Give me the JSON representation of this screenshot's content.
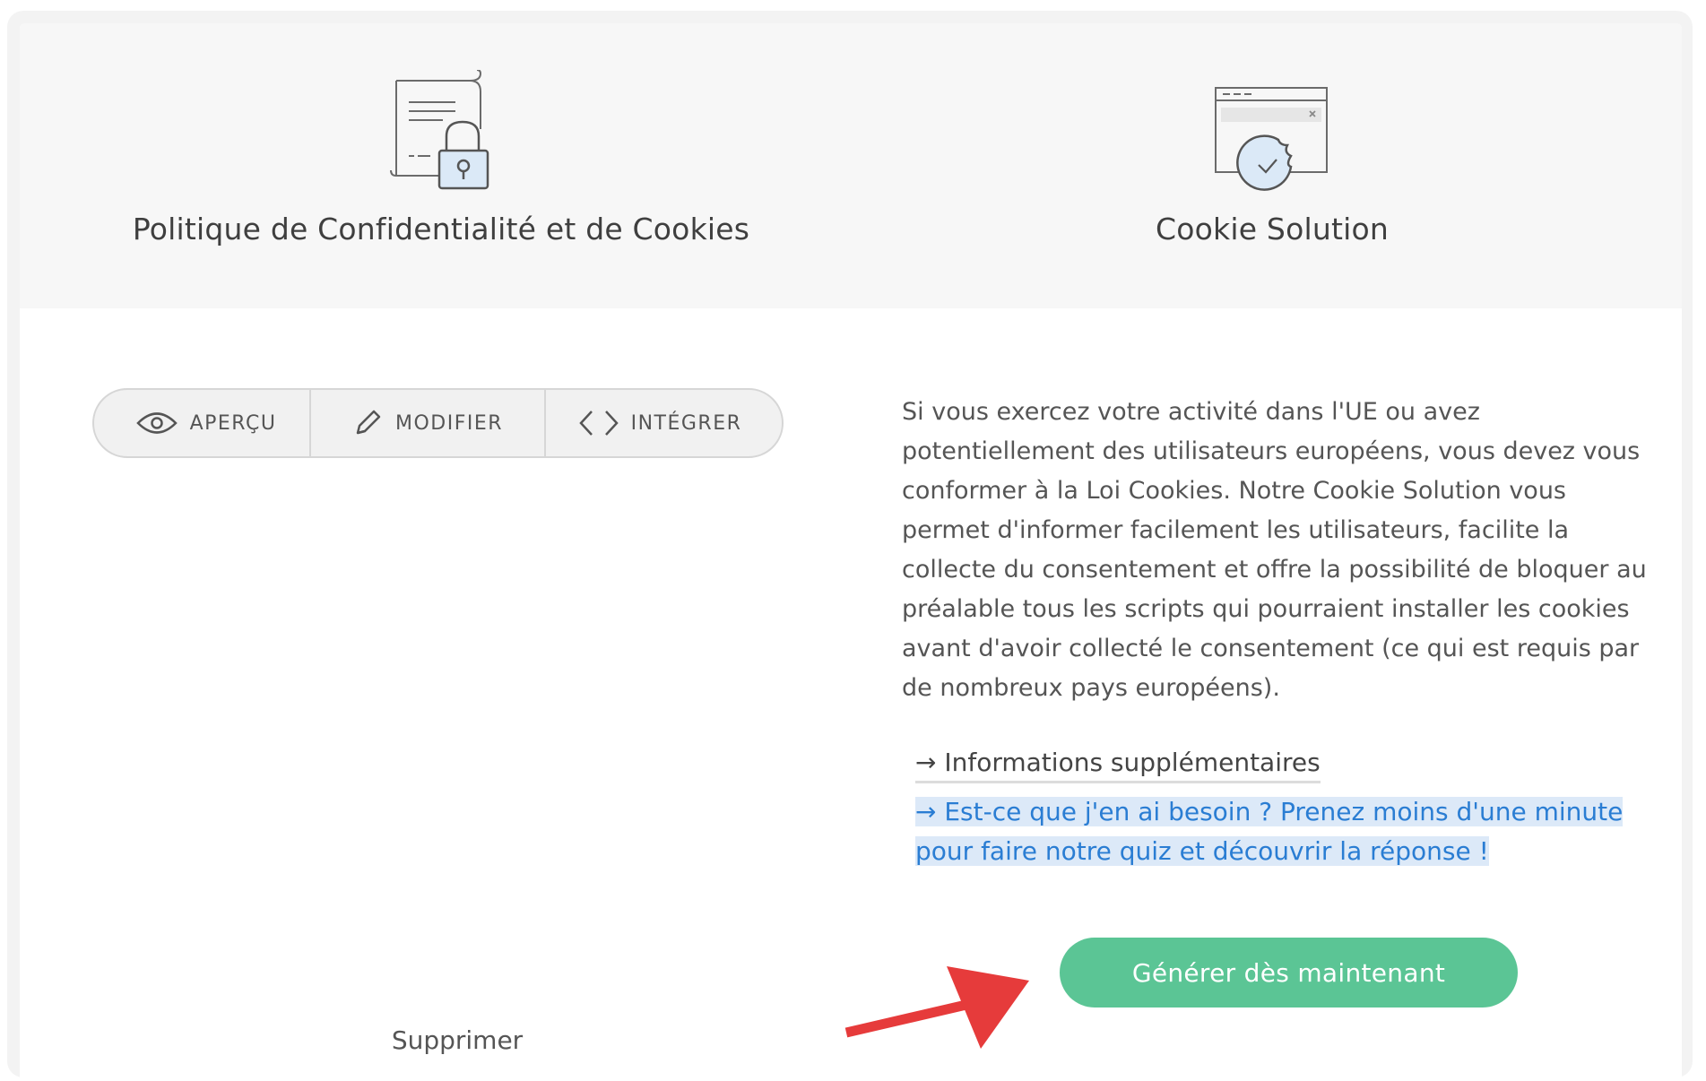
{
  "columns": [
    {
      "title": "Politique de Confidentialité et de Cookies",
      "icon": "document-lock-icon"
    },
    {
      "title": "Cookie Solution",
      "icon": "cookie-banner-icon"
    }
  ],
  "tabs": [
    {
      "label": "APERÇU",
      "icon": "eye-icon"
    },
    {
      "label": "MODIFIER",
      "icon": "pencil-icon"
    },
    {
      "label": "INTÉGRER",
      "icon": "code-icon"
    }
  ],
  "description": "Si vous exercez votre activité dans l'UE ou avez potentiellement des utilisateurs européens, vous devez vous conformer à la Loi Cookies. Notre Cookie Solution vous permet d'informer facilement les utilisateurs, facilite la collecte du consentement et offre la possibilité de bloquer au préalable tous les scripts qui pourraient installer les cookies avant d'avoir collecté le consentement (ce qui est requis par de nombreux pays européens).",
  "links": {
    "more_info": "→ Informations supplémentaires",
    "quiz": "→ Est-ce que j'en ai besoin ? Prenez moins d'une minute pour faire notre quiz et découvrir la réponse !"
  },
  "actions": {
    "generate": "Générer dès maintenant",
    "delete": "Supprimer"
  },
  "colors": {
    "accent_green": "#5bc595",
    "link_blue": "#2a7dd3",
    "annotation_red": "#e63b3b"
  }
}
